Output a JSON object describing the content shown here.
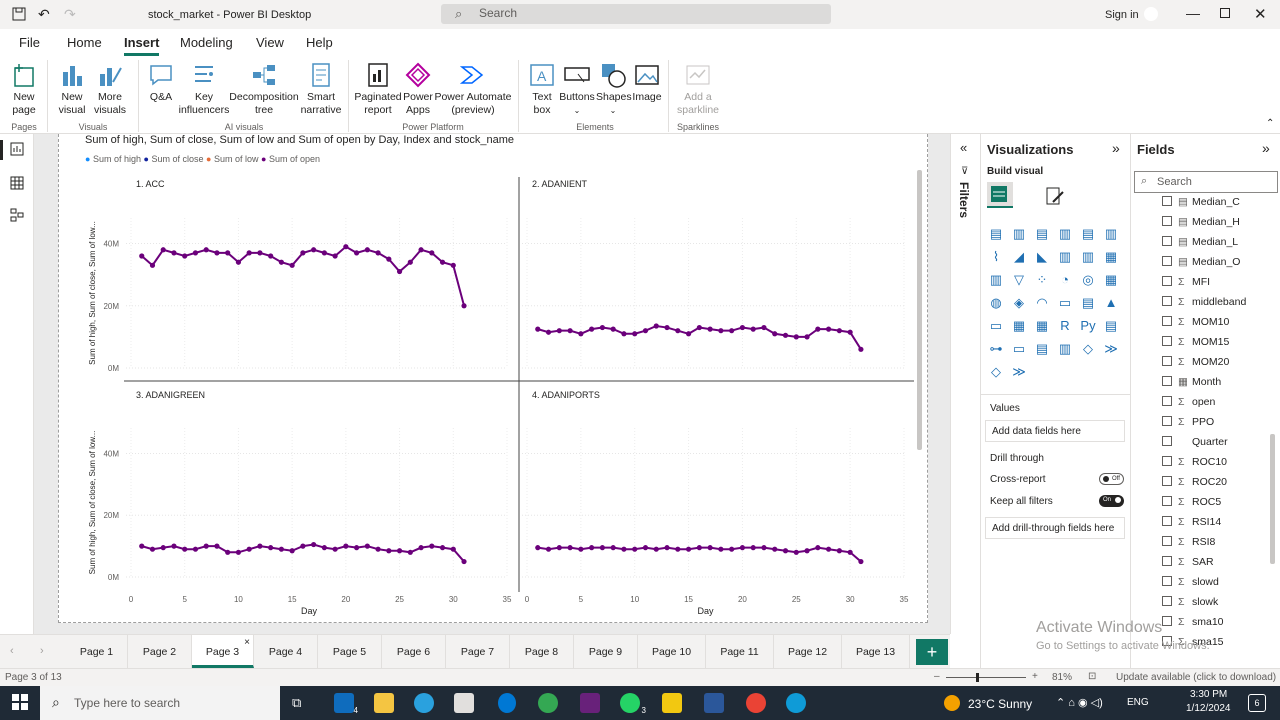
{
  "window": {
    "title": "stock_market - Power BI Desktop",
    "search_placeholder": "Search",
    "signin": "Sign in"
  },
  "menu": [
    "File",
    "Home",
    "Insert",
    "Modeling",
    "View",
    "Help"
  ],
  "ribbon": {
    "buttons": [
      {
        "label": "New\npage",
        "dropdown": true
      },
      {
        "label": "New\nvisual"
      },
      {
        "label": "More\nvisuals",
        "dropdown": true
      },
      {
        "label": "Q&A"
      },
      {
        "label": "Key\ninfluencers"
      },
      {
        "label": "Decomposition\ntree"
      },
      {
        "label": "Smart\nnarrative"
      },
      {
        "label": "Paginated\nreport"
      },
      {
        "label": "Power\nApps"
      },
      {
        "label": "Power Automate\n(preview)"
      },
      {
        "label": "Text\nbox"
      },
      {
        "label": "Buttons"
      },
      {
        "label": "Shapes"
      },
      {
        "label": "Image"
      },
      {
        "label": "Add a\nsparkline"
      }
    ],
    "groups": [
      "Pages",
      "Visuals",
      "AI visuals",
      "Power Platform",
      "Elements",
      "Sparklines"
    ]
  },
  "chart_data": {
    "type": "line",
    "title": "Sum of high, Sum of close, Sum of low and Sum of open by Day, Index and stock_name",
    "legend": [
      {
        "name": "Sum of high",
        "color": "#118dff"
      },
      {
        "name": "Sum of close",
        "color": "#12239e"
      },
      {
        "name": "Sum of low",
        "color": "#e66c37"
      },
      {
        "name": "Sum of open",
        "color": "#6b007b"
      }
    ],
    "xlabel": "Day",
    "ylabel": "Sum of high, Sum of close, Sum of low...",
    "xlim": [
      0,
      35
    ],
    "x_ticks": [
      "0",
      "5",
      "10",
      "15",
      "20",
      "25",
      "30",
      "35"
    ],
    "y_ticks": [
      "0M",
      "20M",
      "40M"
    ],
    "ylim": [
      0,
      45
    ],
    "x": [
      1,
      2,
      3,
      4,
      5,
      6,
      7,
      8,
      9,
      10,
      11,
      12,
      13,
      14,
      15,
      16,
      17,
      18,
      19,
      20,
      21,
      22,
      23,
      24,
      25,
      26,
      27,
      28,
      29,
      30,
      31
    ],
    "panels": [
      {
        "name": "1. ACC",
        "values": [
          36,
          33,
          38,
          37,
          36,
          37,
          38,
          37,
          37,
          34,
          37,
          37,
          36,
          34,
          33,
          37,
          38,
          37,
          36,
          39,
          37,
          38,
          37,
          35,
          31,
          34,
          38,
          37,
          34,
          33,
          20
        ]
      },
      {
        "name": "2. ADANIENT",
        "values": [
          12.5,
          11.5,
          12,
          12,
          11,
          12.5,
          13,
          12.5,
          11,
          11,
          12,
          13.5,
          13,
          12,
          11,
          13,
          12.5,
          12,
          12,
          13,
          12.5,
          13,
          11,
          10.5,
          10,
          10,
          12.5,
          12.5,
          12,
          11.5,
          6
        ]
      },
      {
        "name": "3. ADANIGREEN",
        "values": [
          10,
          9,
          9.5,
          10,
          9,
          9,
          10,
          10,
          8,
          8,
          9,
          10,
          9.5,
          9,
          8.5,
          10,
          10.5,
          9.5,
          9,
          10,
          9.5,
          10,
          9,
          8.5,
          8.5,
          8,
          9.5,
          10,
          9.5,
          9,
          5
        ]
      },
      {
        "name": "4. ADANIPORTS",
        "values": [
          9.5,
          9,
          9.5,
          9.5,
          9,
          9.5,
          9.5,
          9.5,
          9,
          9,
          9.5,
          9,
          9.5,
          9,
          9,
          9.5,
          9.5,
          9,
          9,
          9.5,
          9.5,
          9.5,
          9,
          8.5,
          8,
          8.5,
          9.5,
          9,
          8.5,
          8,
          5
        ]
      }
    ]
  },
  "visualizations": {
    "title": "Visualizations",
    "build_visual": "Build visual",
    "values_label": "Values",
    "values_placeholder": "Add data fields here",
    "drill_through": "Drill through",
    "cross_report": "Cross-report",
    "cross_report_state": "Off",
    "keep_all_filters": "Keep all filters",
    "keep_all_filters_state": "On",
    "drill_placeholder": "Add drill-through fields here"
  },
  "filters_label": "Filters",
  "fields": {
    "title": "Fields",
    "search_placeholder": "Search",
    "items": [
      {
        "name": "Median_C",
        "type": "calc"
      },
      {
        "name": "Median_H",
        "type": "calc"
      },
      {
        "name": "Median_L",
        "type": "calc"
      },
      {
        "name": "Median_O",
        "type": "calc"
      },
      {
        "name": "MFI",
        "type": "sum"
      },
      {
        "name": "middleband",
        "type": "sum"
      },
      {
        "name": "MOM10",
        "type": "sum"
      },
      {
        "name": "MOM15",
        "type": "sum"
      },
      {
        "name": "MOM20",
        "type": "sum"
      },
      {
        "name": "Month",
        "type": "table"
      },
      {
        "name": "open",
        "type": "sum"
      },
      {
        "name": "PPO",
        "type": "sum"
      },
      {
        "name": "Quarter",
        "type": "none"
      },
      {
        "name": "ROC10",
        "type": "sum"
      },
      {
        "name": "ROC20",
        "type": "sum"
      },
      {
        "name": "ROC5",
        "type": "sum"
      },
      {
        "name": "RSI14",
        "type": "sum"
      },
      {
        "name": "RSI8",
        "type": "sum"
      },
      {
        "name": "SAR",
        "type": "sum"
      },
      {
        "name": "slowd",
        "type": "sum"
      },
      {
        "name": "slowk",
        "type": "sum"
      },
      {
        "name": "sma10",
        "type": "sum"
      },
      {
        "name": "sma15",
        "type": "sum"
      }
    ]
  },
  "pages": [
    "Page 1",
    "Page 2",
    "Page 3",
    "Page 4",
    "Page 5",
    "Page 6",
    "Page 7",
    "Page 8",
    "Page 9",
    "Page 10",
    "Page 11",
    "Page 12",
    "Page 13"
  ],
  "active_page": "Page 3",
  "status": {
    "page_indicator": "Page 3 of 13",
    "zoom": "81%",
    "update": "Update available (click to download)",
    "watermark_line1": "Activate Windows",
    "watermark_line2": "Go to Settings to activate Windows."
  },
  "taskbar": {
    "search_placeholder": "Type here to search",
    "weather": "23°C  Sunny",
    "lang": "ENG",
    "time": "3:30 PM",
    "date": "1/12/2024",
    "mail_badge": "4",
    "whatsapp_badge": "3",
    "notification_badge": "6"
  }
}
